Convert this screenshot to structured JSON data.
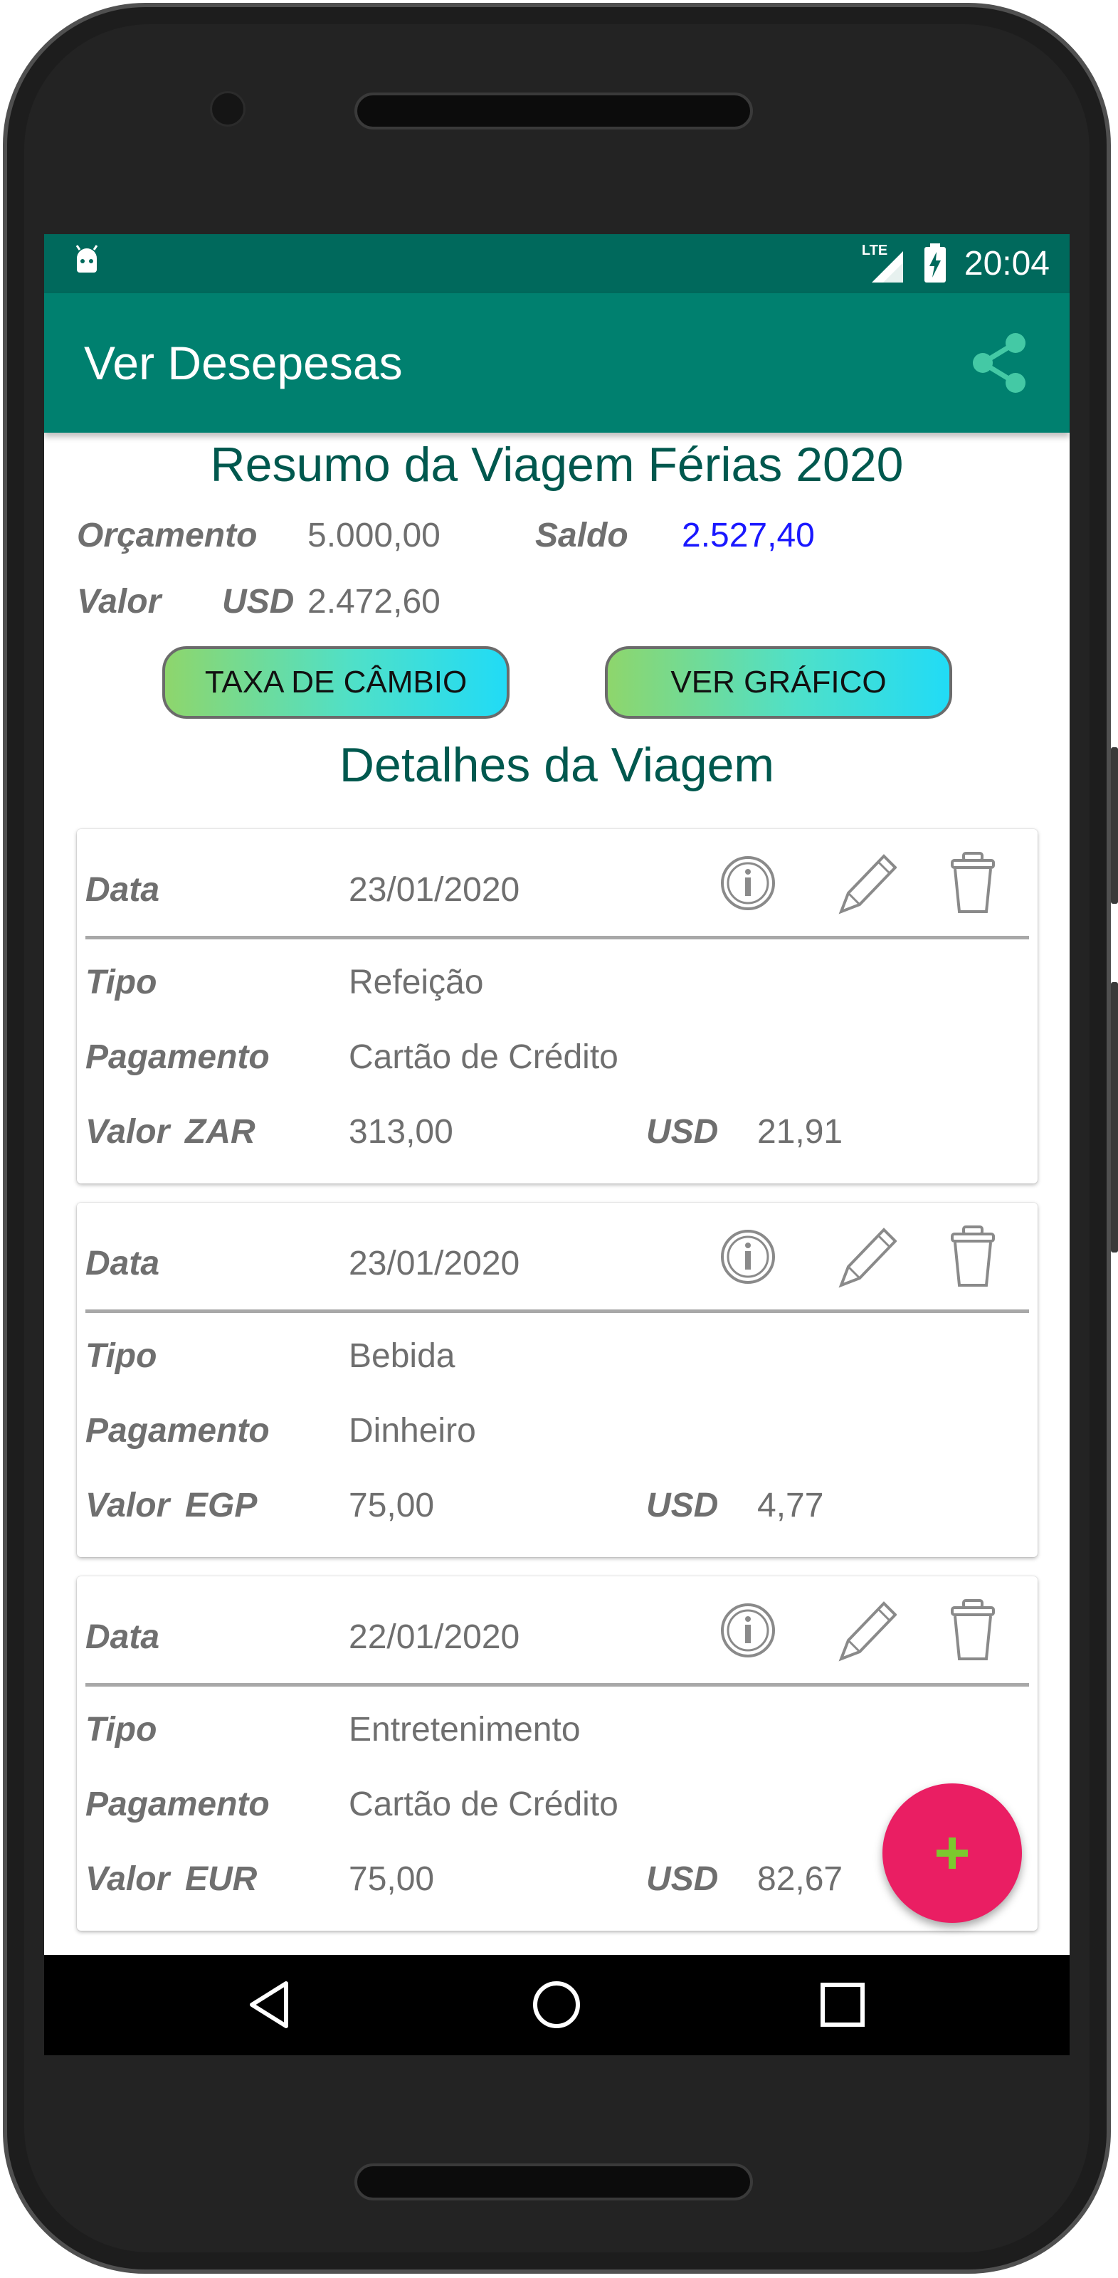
{
  "status_bar": {
    "network": "LTE",
    "time": "20:04"
  },
  "app_bar": {
    "title": "Ver Desepesas",
    "share_icon": "share-icon"
  },
  "summary": {
    "title": "Resumo da Viagem Férias 2020",
    "budget_label": "Orçamento",
    "budget_value": "5.000,00",
    "balance_label": "Saldo",
    "balance_value": "2.527,40",
    "value_label": "Valor",
    "currency": "USD",
    "value_amount": "2.472,60",
    "balance_color": "#1a18ff"
  },
  "buttons": {
    "exchange_rate": "TAXA DE CÂMBIO",
    "view_chart": "VER GRÁFICO"
  },
  "details_title": "Detalhes da Viagem",
  "labels": {
    "date": "Data",
    "type": "Tipo",
    "payment": "Pagamento",
    "value": "Valor",
    "base_currency": "USD"
  },
  "expenses": [
    {
      "date": "23/01/2020",
      "type": "Refeição",
      "payment": "Cartão de Crédito",
      "currency": "ZAR",
      "amount": "313,00",
      "usd": "21,91"
    },
    {
      "date": "23/01/2020",
      "type": "Bebida",
      "payment": "Dinheiro",
      "currency": "EGP",
      "amount": "75,00",
      "usd": "4,77"
    },
    {
      "date": "22/01/2020",
      "type": "Entretenimento",
      "payment": "Cartão de Crédito",
      "currency": "EUR",
      "amount": "75,00",
      "usd": "82,67"
    }
  ],
  "fab": {
    "icon": "plus-icon",
    "color": "#ea1e63"
  },
  "nav": {
    "back_icon": "back-triangle-icon",
    "home_icon": "home-circle-icon",
    "recents_icon": "recents-square-icon"
  },
  "colors": {
    "status_bar": "#00695c",
    "app_bar": "#00806f",
    "heading": "#00584e"
  }
}
